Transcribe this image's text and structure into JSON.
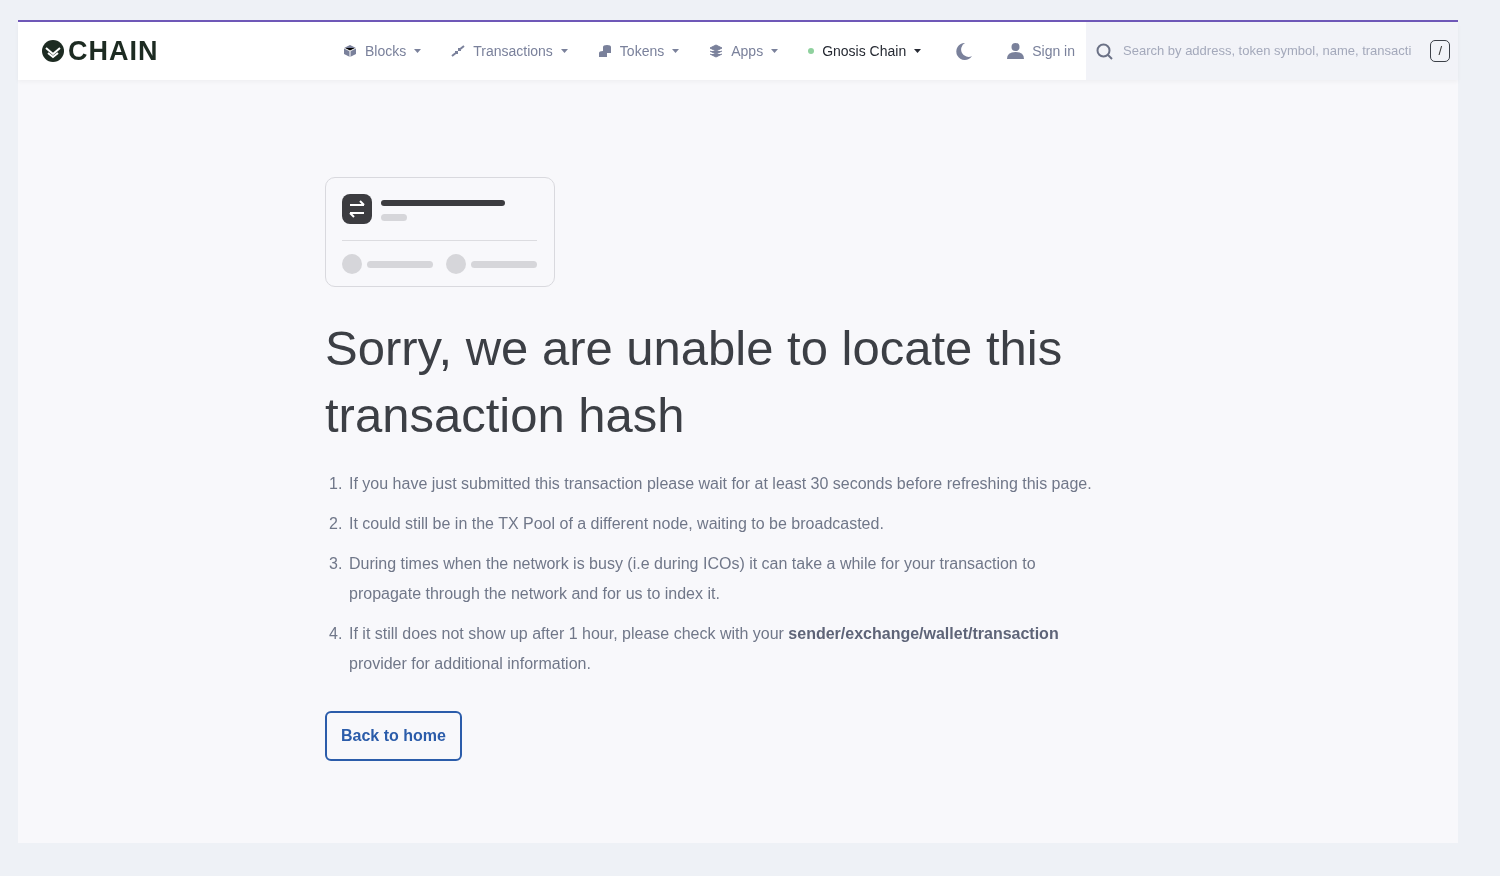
{
  "header": {
    "logo": "CHAIN",
    "nav": [
      {
        "label": "Blocks"
      },
      {
        "label": "Transactions"
      },
      {
        "label": "Tokens"
      },
      {
        "label": "Apps"
      }
    ],
    "network": {
      "label": "Gnosis Chain",
      "color": "#8fd19e"
    },
    "theme_toggle": {
      "dark": false
    },
    "sign_in": "Sign in",
    "search": {
      "placeholder": "Search by address, token symbol, name, transacti",
      "shortcut": "/"
    }
  },
  "error": {
    "title": "Sorry, we are unable to locate this transaction hash",
    "reasons": [
      {
        "marker": "1.",
        "text": "If you have just submitted this transaction please wait for at least 30 seconds before refreshing this page."
      },
      {
        "marker": "2.",
        "text": "It could still be in the TX Pool of a different node, waiting to be broadcasted."
      },
      {
        "marker": "3.",
        "text": "During times when the network is busy (i.e during ICOs) it can take a while for your transaction to propagate through the network and for us to index it."
      },
      {
        "marker": "4.",
        "text": "If it still does not show up after 1 hour, please check with your **sender/exchange/wallet/transaction** provider for additional information."
      }
    ],
    "button": "Back to home"
  }
}
